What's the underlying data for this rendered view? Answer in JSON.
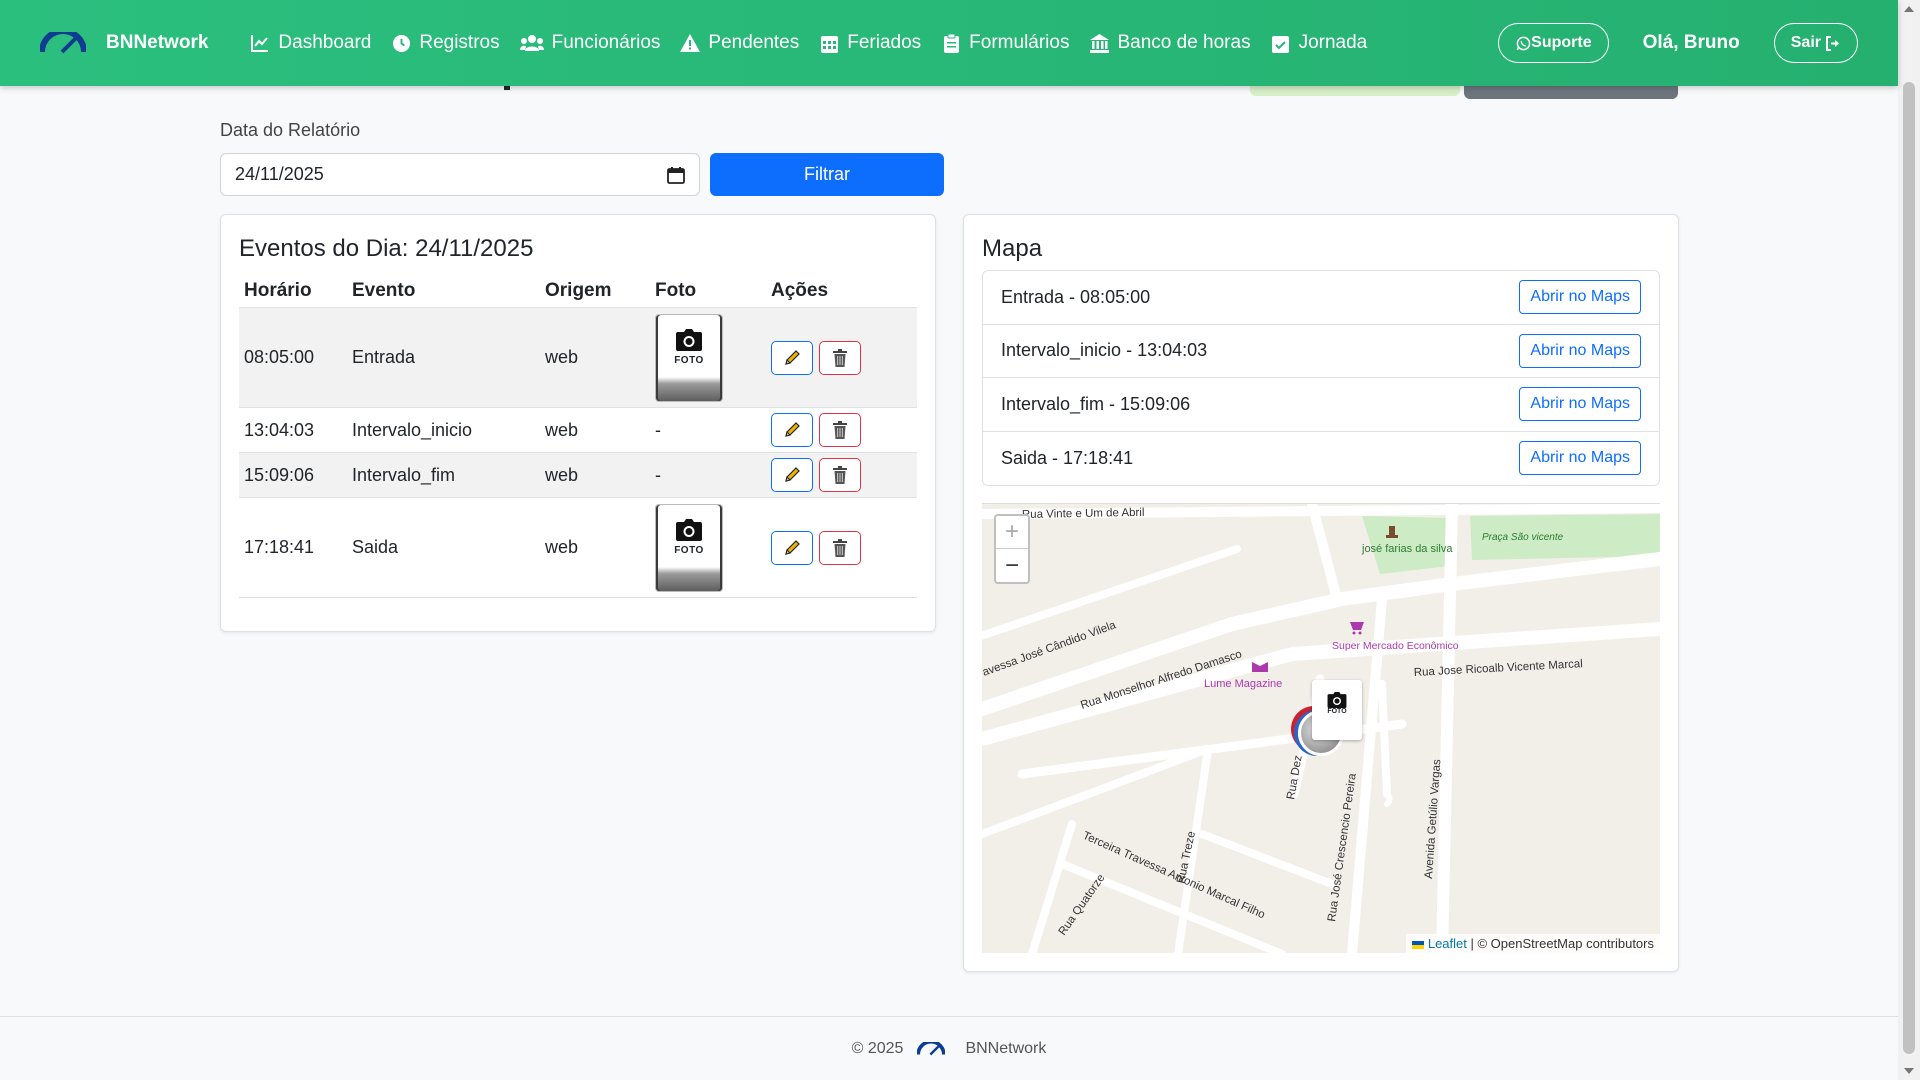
{
  "navbar": {
    "brand": "BNNetwork",
    "links": [
      {
        "label": "Dashboard",
        "icon": "chart-line-icon"
      },
      {
        "label": "Registros",
        "icon": "clock-icon"
      },
      {
        "label": "Funcionários",
        "icon": "users-icon"
      },
      {
        "label": "Pendentes",
        "icon": "warning-icon"
      },
      {
        "label": "Feriados",
        "icon": "calendar-icon"
      },
      {
        "label": "Formulários",
        "icon": "clipboard-icon"
      },
      {
        "label": "Banco de horas",
        "icon": "bank-icon"
      },
      {
        "label": "Jornada",
        "icon": "calendar-check-icon"
      }
    ],
    "support_label": "Suporte",
    "greeting": "Olá, Bruno",
    "logout_label": "Sair"
  },
  "filter": {
    "label": "Data do Relatório",
    "date_value": "24/11/2025",
    "button_label": "Filtrar"
  },
  "events": {
    "title": "Eventos do Dia: 24/11/2025",
    "columns": [
      "Horário",
      "Evento",
      "Origem",
      "Foto",
      "Ações"
    ],
    "photo_label": "FOTO",
    "rows": [
      {
        "time": "08:05:00",
        "event": "Entrada",
        "origin": "web",
        "photo": "FOTO",
        "no_photo": ""
      },
      {
        "time": "13:04:03",
        "event": "Intervalo_inicio",
        "origin": "web",
        "photo": "",
        "no_photo": "-"
      },
      {
        "time": "15:09:06",
        "event": "Intervalo_fim",
        "origin": "web",
        "photo": "",
        "no_photo": "-"
      },
      {
        "time": "17:18:41",
        "event": "Saida",
        "origin": "web",
        "photo": "FOTO",
        "no_photo": ""
      }
    ]
  },
  "map": {
    "title": "Mapa",
    "button_label": "Abrir no Maps",
    "items": [
      {
        "label": "Entrada - 08:05:00"
      },
      {
        "label": "Intervalo_inicio - 13:04:03"
      },
      {
        "label": "Intervalo_fim - 15:09:06"
      },
      {
        "label": "Saida - 17:18:41"
      }
    ],
    "zoom_in": "+",
    "zoom_out": "−",
    "attribution_link": "Leaflet",
    "attribution_text": " | © OpenStreetMap contributors",
    "marker_label": "FOTO",
    "streets": [
      "Rua Vinte e Um de Abril",
      "avessa José Cândido Vilela",
      "Rua Monselhor Alfredo Damasco",
      "Rua Jose Ricoalb Vicente Marcal",
      "Rua Dez",
      "Rua José Crescencio Pereira",
      "Avenida Getúlio Vargas",
      "Terceira Travessa Antonio Marcal Filho",
      "Rua Treze",
      "Rua Quatorze"
    ],
    "pois": {
      "jose_farias": "josé farias da silva",
      "praca": "Praça São vicente",
      "lume": "Lume Magazine",
      "super_mercado": "Super Mercado Econômico"
    }
  },
  "footer": {
    "copyright": "© 2025",
    "brand": "BNNetwork"
  },
  "colors": {
    "navbar": "#27b778",
    "primary": "#0d6efd",
    "danger": "#dc3545",
    "brand_logo": "#0d47a1"
  }
}
